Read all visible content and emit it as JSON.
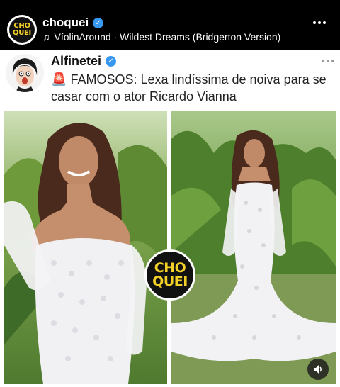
{
  "header": {
    "account_name": "choquei",
    "logo_line1": "CHO",
    "logo_line2": "QUEI",
    "music": "VíolinAround · Wildest Dreams (Bridgerton Version)",
    "music_icon": "music-note-icon",
    "more_icon": "more-horizontal-icon"
  },
  "post": {
    "author": "Alfinetei",
    "siren_icon": "siren-icon",
    "text": "FAMOSOS: Lexa lindíssima de noiva para se casar com o ator Ricardo Vianna",
    "badge_line1": "CHO",
    "badge_line2": "QUEI",
    "sound_icon": "speaker-icon"
  },
  "colors": {
    "verified": "#3897f0",
    "brand_yellow": "#f2d027",
    "background": "#000000",
    "card": "#ffffff"
  }
}
